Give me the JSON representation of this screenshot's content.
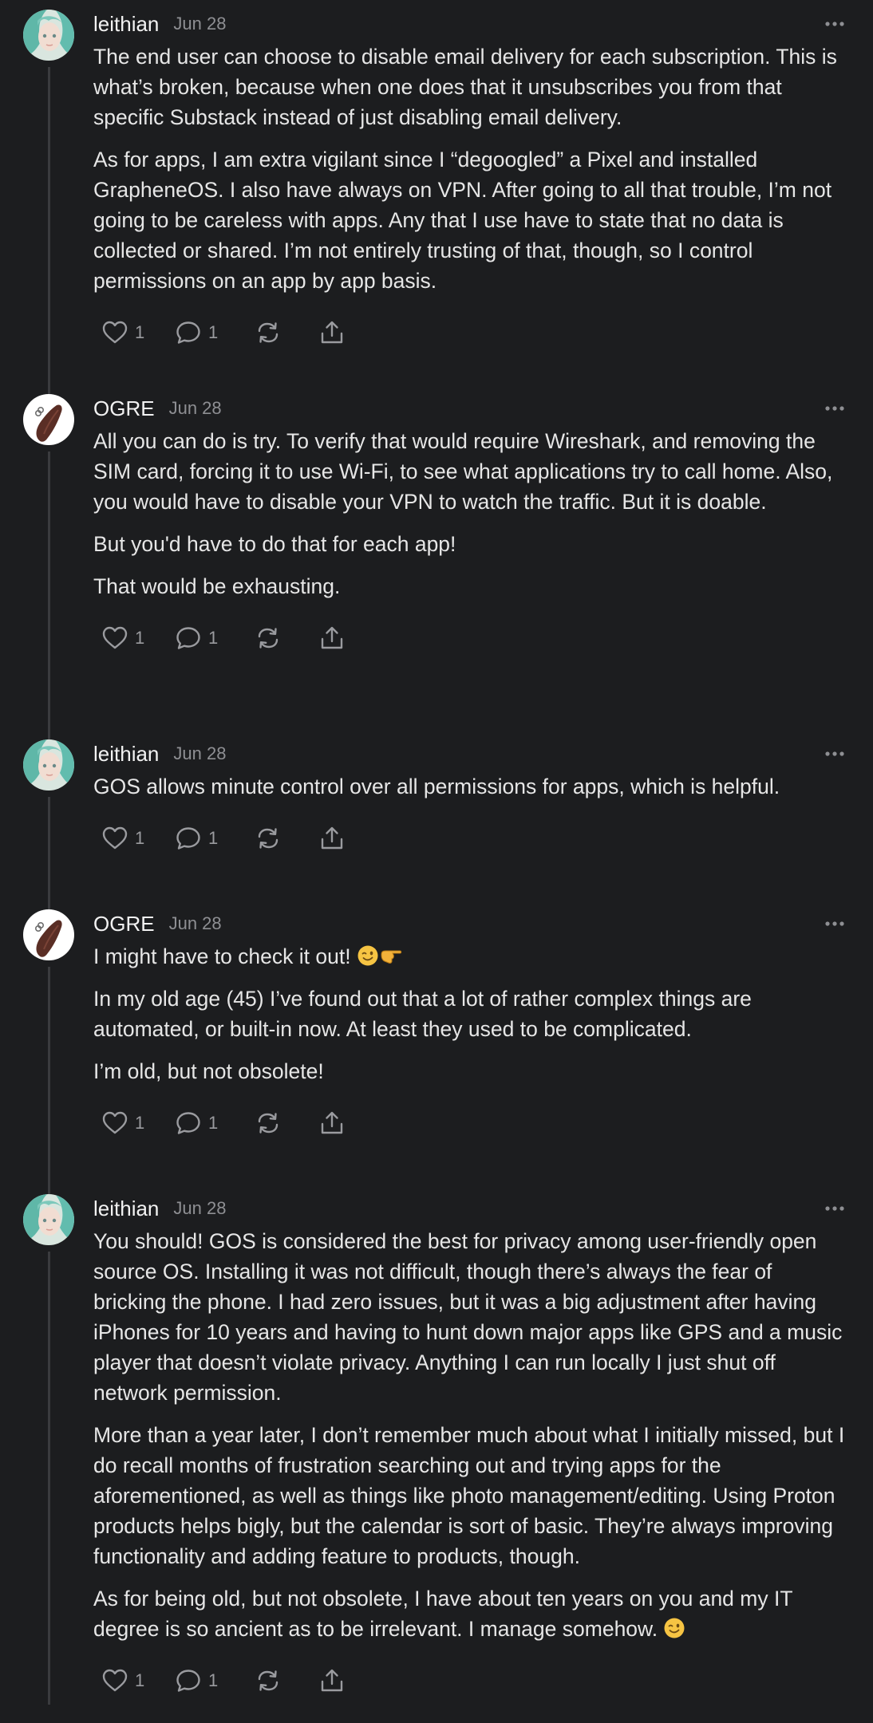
{
  "comments": [
    {
      "author": "leithian",
      "date": "Jun 28",
      "avatar": "leithian-avatar",
      "paragraphs": [
        "The end user can choose to disable email delivery for each subscription. This is what’s broken, because when one does that it unsubscribes you from that specific Substack instead of just disabling email delivery.",
        "As for apps, I am extra vigilant since I “degoogled” a Pixel and installed GrapheneOS. I also have always on VPN. After going to all that trouble, I’m not going to be careless with apps. Any that I use have to state that no data is collected or shared. I’m not entirely trusting of that, though, so I control permissions on an app by app basis."
      ],
      "likes": "1",
      "replies": "1"
    },
    {
      "author": "OGRE",
      "date": "Jun 28",
      "avatar": "ogre-avatar",
      "paragraphs": [
        "All you can do is try. To verify that would require Wireshark, and removing the SIM card, forcing it to use Wi-Fi, to see what applications try to call home. Also, you would have to disable your VPN to watch the traffic. But it is doable.",
        "But you'd have to do that for each app!",
        "That would be exhausting."
      ],
      "likes": "1",
      "replies": "1"
    },
    {
      "author": "leithian",
      "date": "Jun 28",
      "avatar": "leithian-avatar",
      "paragraphs": [
        "GOS allows minute control over all permissions for apps, which is helpful."
      ],
      "likes": "1",
      "replies": "1"
    },
    {
      "author": "OGRE",
      "date": "Jun 28",
      "avatar": "ogre-avatar",
      "paragraphs": [
        "I might have to check it out!",
        "In my old age (45) I’ve found out that a lot of rather complex things are automated, or built-in now. At least they used to be complicated.",
        "I’m old, but not obsolete!"
      ],
      "paragraph_emojis": {
        "0": [
          "winking-face-emoji",
          "pointing-hand-emoji"
        ]
      },
      "likes": "1",
      "replies": "1"
    },
    {
      "author": "leithian",
      "date": "Jun 28",
      "avatar": "leithian-avatar",
      "paragraphs": [
        "You should! GOS is considered the best for privacy among user-friendly open source OS. Installing it was not difficult, though there’s always the fear of bricking the phone. I had zero issues, but it was a big adjustment after having iPhones for 10 years and having to hunt down major apps like GPS and a music player that doesn’t violate privacy. Anything I can run locally I just shut off network permission.",
        "More than a year later, I don’t remember much about what I initially missed, but I do recall months of frustration searching out and trying apps for the aforementioned, as well as things like photo management/editing. Using Proton products helps bigly, but the calendar is sort of basic. They’re always improving functionality and adding feature to products, though.",
        "As for being old, but not obsolete, I have about ten years on you and my IT degree is so ancient as to be irrelevant. I manage somehow."
      ],
      "paragraph_emojis": {
        "2": [
          "winking-face-emoji"
        ]
      },
      "likes": "1",
      "replies": "1"
    }
  ],
  "icons": {
    "like": "heart-icon",
    "reply": "speech-bubble-icon",
    "restack": "restack-icon",
    "share": "share-icon",
    "more": "more-dots-icon"
  },
  "colors": {
    "background": "#1c1d1f",
    "text": "#e6e6e6",
    "muted": "#8e8f93",
    "thread_line": "#3a3b3e"
  }
}
